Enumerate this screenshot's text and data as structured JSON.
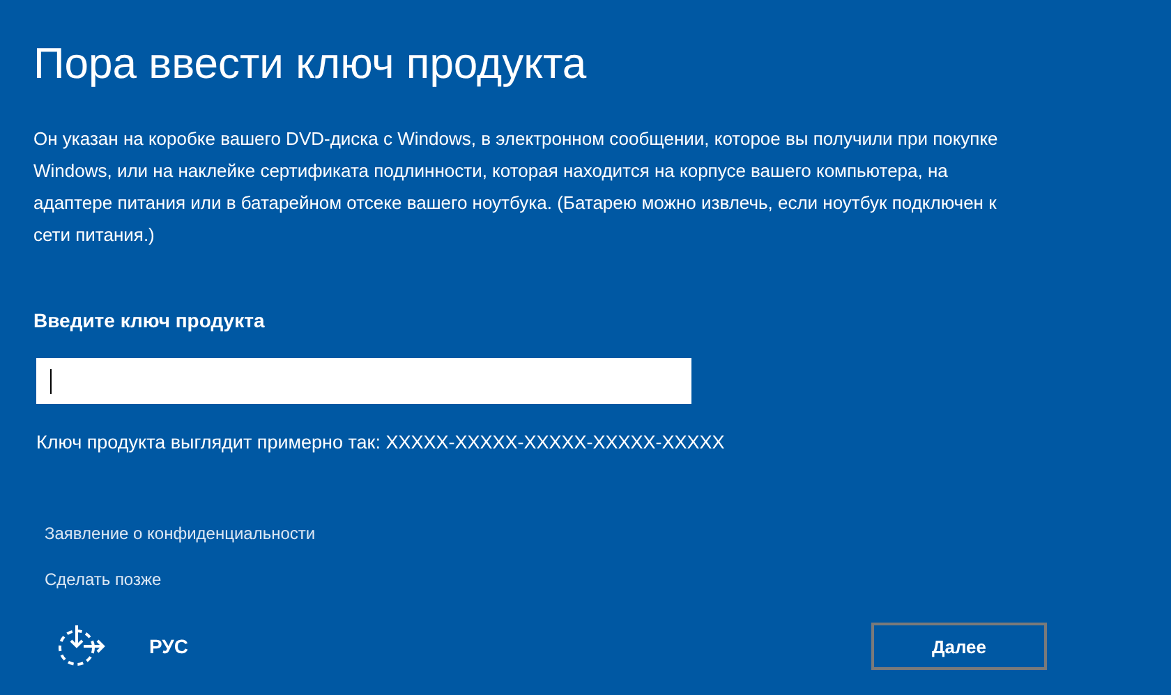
{
  "title": "Пора ввести ключ продукта",
  "description": "Он указан на коробке вашего DVD-диска с Windows, в электронном сообщении, которое вы получили при покупке Windows, или на наклейке сертификата подлинности, которая находится на корпусе вашего компьютера, на адаптере питания или в батарейном отсеке вашего ноутбука. (Батарею можно извлечь, если ноутбук подключен к сети питания.)",
  "key_field": {
    "label": "Введите ключ продукта"
  },
  "hint": "Ключ продукта выглядит примерно так: XXXXX-XXXXX-XXXXX-XXXXX-XXXXX",
  "links": [
    "Заявление о конфиденциальности",
    "Сделать позже"
  ],
  "footer": {
    "language": "РУС",
    "next_button": "Далее"
  }
}
